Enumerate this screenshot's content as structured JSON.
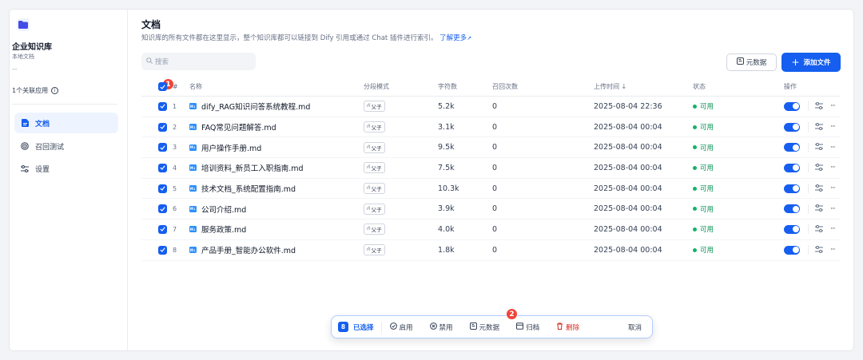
{
  "sidebar": {
    "kb_name": "企业知识库",
    "kb_type": "本地文档",
    "kb_dash": "--",
    "linked_apps": "1个关联应用",
    "nav": [
      {
        "label": "文档",
        "icon": "document-icon",
        "active": true
      },
      {
        "label": "召回测试",
        "icon": "target-icon",
        "active": false
      },
      {
        "label": "设置",
        "icon": "settings-icon",
        "active": false
      }
    ]
  },
  "header": {
    "title": "文档",
    "description": "知识库的所有文件都在这里显示，整个知识库都可以链接到 Dify 引用或通过 Chat 插件进行索引。",
    "learn_more": "了解更多"
  },
  "toolbar": {
    "search_placeholder": "搜索",
    "metadata_label": "元数据",
    "add_file_label": "添加文件"
  },
  "table": {
    "columns": {
      "index": "#",
      "name": "名称",
      "mode": "分段模式",
      "chars": "字符数",
      "hits": "召回次数",
      "uploaded": "上传时间 ↓",
      "status": "状态",
      "actions": "操作"
    },
    "mode_label": "父子",
    "md_icon_text": "M↓",
    "rows": [
      {
        "index": "1",
        "name": "dify_RAG知识问答系统教程.md",
        "chars": "5.2k",
        "hits": "0",
        "uploaded": "2025-08-04 22:36",
        "status": "可用"
      },
      {
        "index": "2",
        "name": "FAQ常见问题解答.md",
        "chars": "3.1k",
        "hits": "0",
        "uploaded": "2025-08-04 00:04",
        "status": "可用"
      },
      {
        "index": "3",
        "name": "用户操作手册.md",
        "chars": "9.5k",
        "hits": "0",
        "uploaded": "2025-08-04 00:04",
        "status": "可用"
      },
      {
        "index": "4",
        "name": "培训资料_新员工入职指南.md",
        "chars": "7.5k",
        "hits": "0",
        "uploaded": "2025-08-04 00:04",
        "status": "可用"
      },
      {
        "index": "5",
        "name": "技术文档_系统配置指南.md",
        "chars": "10.3k",
        "hits": "0",
        "uploaded": "2025-08-04 00:04",
        "status": "可用"
      },
      {
        "index": "6",
        "name": "公司介绍.md",
        "chars": "3.9k",
        "hits": "0",
        "uploaded": "2025-08-04 00:04",
        "status": "可用"
      },
      {
        "index": "7",
        "name": "服务政策.md",
        "chars": "4.0k",
        "hits": "0",
        "uploaded": "2025-08-04 00:04",
        "status": "可用"
      },
      {
        "index": "8",
        "name": "产品手册_智能办公软件.md",
        "chars": "1.8k",
        "hits": "0",
        "uploaded": "2025-08-04 00:04",
        "status": "可用"
      }
    ]
  },
  "annotations": {
    "badge1": "1",
    "badge2": "2"
  },
  "batch_bar": {
    "count": "8",
    "selected_label": "已选择",
    "enable": "启用",
    "disable": "禁用",
    "metadata": "元数据",
    "archive": "归档",
    "delete": "删除",
    "cancel": "取消"
  },
  "colors": {
    "accent": "#155eef",
    "success": "#17b26a",
    "danger": "#d92d20",
    "annotation": "#f04438"
  }
}
